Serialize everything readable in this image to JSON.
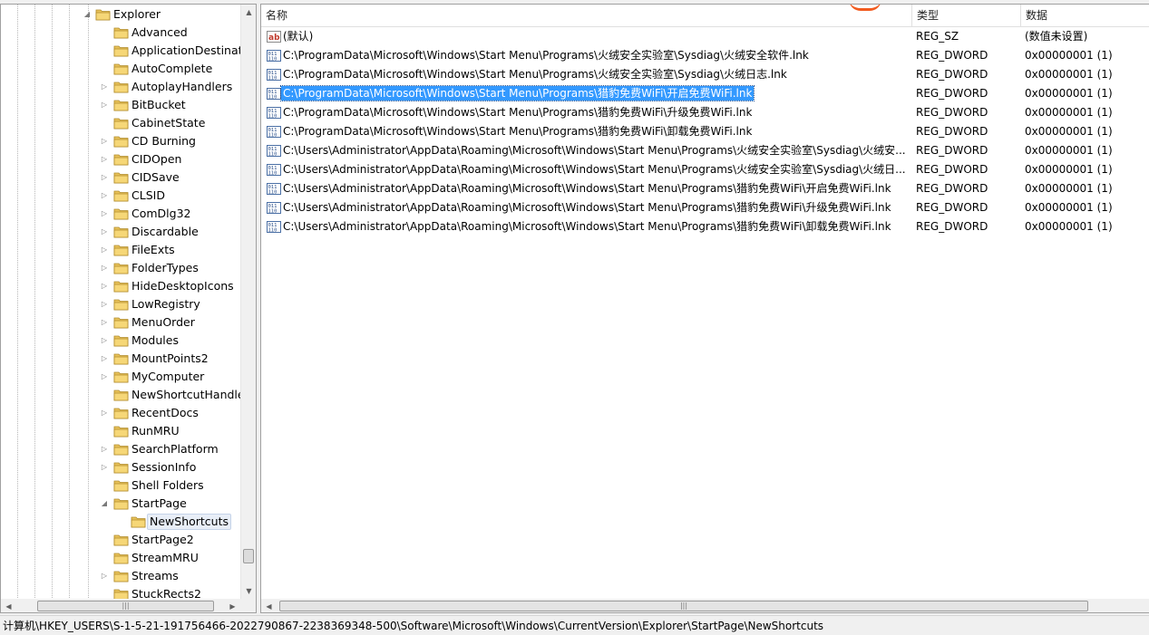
{
  "tree": {
    "items": [
      {
        "label": "Explorer",
        "level": 0,
        "expander": "expanded"
      },
      {
        "label": "Advanced",
        "level": 1,
        "expander": "none"
      },
      {
        "label": "ApplicationDestinatic",
        "level": 1,
        "expander": "none"
      },
      {
        "label": "AutoComplete",
        "level": 1,
        "expander": "none"
      },
      {
        "label": "AutoplayHandlers",
        "level": 1,
        "expander": "collapsed"
      },
      {
        "label": "BitBucket",
        "level": 1,
        "expander": "collapsed"
      },
      {
        "label": "CabinetState",
        "level": 1,
        "expander": "none"
      },
      {
        "label": "CD Burning",
        "level": 1,
        "expander": "collapsed"
      },
      {
        "label": "CIDOpen",
        "level": 1,
        "expander": "collapsed"
      },
      {
        "label": "CIDSave",
        "level": 1,
        "expander": "collapsed"
      },
      {
        "label": "CLSID",
        "level": 1,
        "expander": "collapsed"
      },
      {
        "label": "ComDlg32",
        "level": 1,
        "expander": "collapsed"
      },
      {
        "label": "Discardable",
        "level": 1,
        "expander": "collapsed"
      },
      {
        "label": "FileExts",
        "level": 1,
        "expander": "collapsed"
      },
      {
        "label": "FolderTypes",
        "level": 1,
        "expander": "collapsed"
      },
      {
        "label": "HideDesktopIcons",
        "level": 1,
        "expander": "collapsed"
      },
      {
        "label": "LowRegistry",
        "level": 1,
        "expander": "collapsed"
      },
      {
        "label": "MenuOrder",
        "level": 1,
        "expander": "collapsed"
      },
      {
        "label": "Modules",
        "level": 1,
        "expander": "collapsed"
      },
      {
        "label": "MountPoints2",
        "level": 1,
        "expander": "collapsed"
      },
      {
        "label": "MyComputer",
        "level": 1,
        "expander": "collapsed"
      },
      {
        "label": "NewShortcutHandler",
        "level": 1,
        "expander": "none"
      },
      {
        "label": "RecentDocs",
        "level": 1,
        "expander": "collapsed"
      },
      {
        "label": "RunMRU",
        "level": 1,
        "expander": "none"
      },
      {
        "label": "SearchPlatform",
        "level": 1,
        "expander": "collapsed"
      },
      {
        "label": "SessionInfo",
        "level": 1,
        "expander": "collapsed"
      },
      {
        "label": "Shell Folders",
        "level": 1,
        "expander": "none"
      },
      {
        "label": "StartPage",
        "level": 1,
        "expander": "expanded"
      },
      {
        "label": "NewShortcuts",
        "level": 2,
        "expander": "none",
        "selected": true
      },
      {
        "label": "StartPage2",
        "level": 1,
        "expander": "none"
      },
      {
        "label": "StreamMRU",
        "level": 1,
        "expander": "none"
      },
      {
        "label": "Streams",
        "level": 1,
        "expander": "collapsed"
      },
      {
        "label": "StuckRects2",
        "level": 1,
        "expander": "none"
      }
    ]
  },
  "list": {
    "columns": {
      "name": "名称",
      "type": "类型",
      "data": "数据"
    },
    "rows": [
      {
        "icon": "string-value-icon",
        "name": "(默认)",
        "type": "REG_SZ",
        "data": "(数值未设置)"
      },
      {
        "icon": "binary-value-icon",
        "name": "C:\\ProgramData\\Microsoft\\Windows\\Start Menu\\Programs\\火绒安全实验室\\Sysdiag\\火绒安全软件.lnk",
        "type": "REG_DWORD",
        "data": "0x00000001 (1)"
      },
      {
        "icon": "binary-value-icon",
        "name": "C:\\ProgramData\\Microsoft\\Windows\\Start Menu\\Programs\\火绒安全实验室\\Sysdiag\\火绒日志.lnk",
        "type": "REG_DWORD",
        "data": "0x00000001 (1)"
      },
      {
        "icon": "binary-value-icon",
        "name": "C:\\ProgramData\\Microsoft\\Windows\\Start Menu\\Programs\\猎豹免费WiFi\\开启免费WiFi.lnk",
        "type": "REG_DWORD",
        "data": "0x00000001 (1)",
        "selected": true
      },
      {
        "icon": "binary-value-icon",
        "name": "C:\\ProgramData\\Microsoft\\Windows\\Start Menu\\Programs\\猎豹免费WiFi\\升级免费WiFi.lnk",
        "type": "REG_DWORD",
        "data": "0x00000001 (1)"
      },
      {
        "icon": "binary-value-icon",
        "name": "C:\\ProgramData\\Microsoft\\Windows\\Start Menu\\Programs\\猎豹免费WiFi\\卸载免费WiFi.lnk",
        "type": "REG_DWORD",
        "data": "0x00000001 (1)"
      },
      {
        "icon": "binary-value-icon",
        "name": "C:\\Users\\Administrator\\AppData\\Roaming\\Microsoft\\Windows\\Start Menu\\Programs\\火绒安全实验室\\Sysdiag\\火绒安...",
        "type": "REG_DWORD",
        "data": "0x00000001 (1)"
      },
      {
        "icon": "binary-value-icon",
        "name": "C:\\Users\\Administrator\\AppData\\Roaming\\Microsoft\\Windows\\Start Menu\\Programs\\火绒安全实验室\\Sysdiag\\火绒日...",
        "type": "REG_DWORD",
        "data": "0x00000001 (1)"
      },
      {
        "icon": "binary-value-icon",
        "name": "C:\\Users\\Administrator\\AppData\\Roaming\\Microsoft\\Windows\\Start Menu\\Programs\\猎豹免费WiFi\\开启免费WiFi.lnk",
        "type": "REG_DWORD",
        "data": "0x00000001 (1)"
      },
      {
        "icon": "binary-value-icon",
        "name": "C:\\Users\\Administrator\\AppData\\Roaming\\Microsoft\\Windows\\Start Menu\\Programs\\猎豹免费WiFi\\升级免费WiFi.lnk",
        "type": "REG_DWORD",
        "data": "0x00000001 (1)"
      },
      {
        "icon": "binary-value-icon",
        "name": "C:\\Users\\Administrator\\AppData\\Roaming\\Microsoft\\Windows\\Start Menu\\Programs\\猎豹免费WiFi\\卸载免费WiFi.lnk",
        "type": "REG_DWORD",
        "data": "0x00000001 (1)"
      }
    ]
  },
  "status": {
    "path": "计算机\\HKEY_USERS\\S-1-5-21-191756466-2022790867-2238369348-500\\Software\\Microsoft\\Windows\\CurrentVersion\\Explorer\\StartPage\\NewShortcuts"
  },
  "colors": {
    "selection": "#3399ff",
    "folder": "#e8c25a",
    "accent_mark": "#f25b1f"
  }
}
